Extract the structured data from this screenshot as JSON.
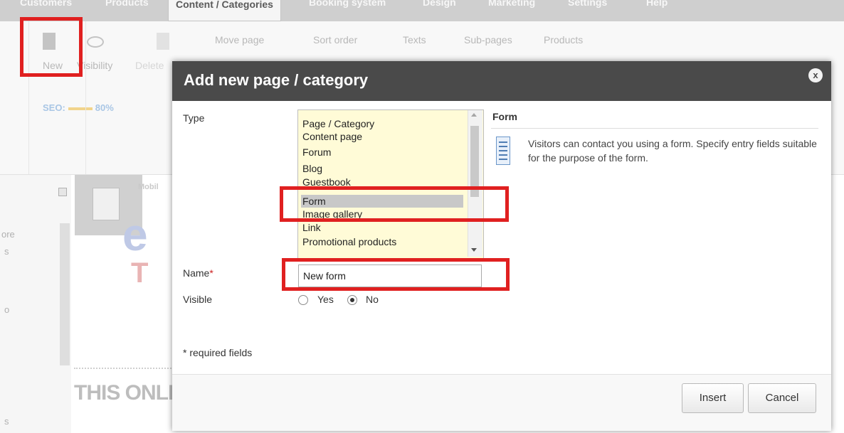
{
  "app": {
    "nav_tabs": [
      "Customers",
      "Products",
      "Content / Categories",
      "Booking system",
      "Design",
      "Marketing",
      "Settings",
      "Help"
    ],
    "toolbar": {
      "new_label": "New",
      "visibility_label": "Visibility",
      "delete_label": "Delete",
      "move_page_label": "Move page",
      "sort_order_label": "Sort order",
      "texts_label": "Texts",
      "sub_pages_label": "Sub-pages",
      "products_label": "Products",
      "seo_label": "SEO:",
      "seo_value": "80%"
    },
    "background": {
      "mobile_label": "Mobil",
      "online_text": "THIS ONLIN",
      "rail_texts": [
        "ore",
        "s",
        "o",
        "s"
      ]
    }
  },
  "dialog": {
    "title": "Add new page / category",
    "close_label": "x",
    "type_label": "Type",
    "type_options": [
      "Page / Category",
      "Content page",
      "Forum",
      "Blog",
      "Guestbook",
      "Form",
      "Image gallery",
      "Link",
      "Promotional products"
    ],
    "selected_type": "Form",
    "info_title": "Form",
    "info_text": "Visitors can contact you using a form. Specify entry fields suitable for the purpose of the form.",
    "name_label": "Name",
    "name_required_mark": "*",
    "name_value": "New form",
    "visible_label": "Visible",
    "visible_options": [
      "Yes",
      "No"
    ],
    "visible_selected": "No",
    "required_note": "* required fields",
    "insert_label": "Insert",
    "cancel_label": "Cancel"
  },
  "colors": {
    "header": "#4a4a4a",
    "list_bg": "#fffbd7",
    "annotation": "#e02020"
  }
}
